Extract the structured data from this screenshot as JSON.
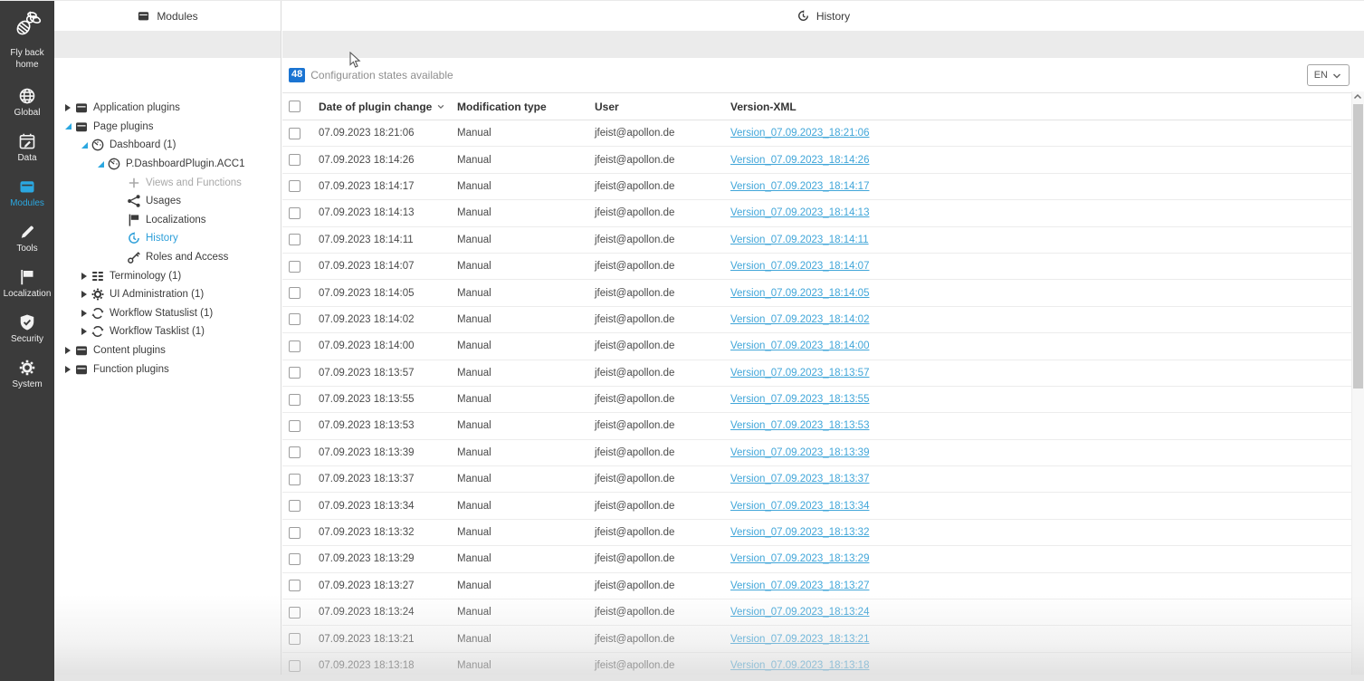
{
  "colors": {
    "accent": "#2ba7e0",
    "badge": "#1b74d2",
    "link": "#41a6d9",
    "sidebar_bg": "#3b3b3b"
  },
  "sidebar": {
    "logo": {
      "label": "Fly back home",
      "icon": "bee-icon"
    },
    "items": [
      {
        "label": "Global",
        "icon": "globe-icon",
        "active": false
      },
      {
        "label": "Data",
        "icon": "calendar-icon",
        "active": false
      },
      {
        "label": "Modules",
        "icon": "module-icon",
        "active": true
      },
      {
        "label": "Tools",
        "icon": "pencil-icon",
        "active": false
      },
      {
        "label": "Localization",
        "icon": "flag-icon",
        "active": false
      },
      {
        "label": "Security",
        "icon": "shield-icon",
        "active": false
      },
      {
        "label": "System",
        "icon": "gear-wrench-icon",
        "active": false
      }
    ]
  },
  "tree_panel": {
    "header": {
      "label": "Modules",
      "icon": "module-icon"
    },
    "items": [
      {
        "label": "Application plugins",
        "icon": "module-icon",
        "level": 0,
        "arrow": "collapsed",
        "state": "normal"
      },
      {
        "label": "Page plugins",
        "icon": "module-icon",
        "level": 0,
        "arrow": "expanded",
        "state": "normal"
      },
      {
        "label": "Dashboard (1)",
        "icon": "dashboard-icon",
        "level": 1,
        "arrow": "expanded",
        "state": "normal"
      },
      {
        "label": "P.DashboardPlugin.ACC1",
        "icon": "dashboard-icon",
        "level": 2,
        "arrow": "expanded",
        "state": "normal"
      },
      {
        "label": "Views and Functions",
        "icon": "plus-icon",
        "level": 3,
        "arrow": "none",
        "state": "muted"
      },
      {
        "label": "Usages",
        "icon": "usages-icon",
        "level": 3,
        "arrow": "none",
        "state": "normal"
      },
      {
        "label": "Localizations",
        "icon": "flag-icon",
        "level": 3,
        "arrow": "none",
        "state": "normal"
      },
      {
        "label": "History",
        "icon": "history-icon",
        "level": 3,
        "arrow": "none",
        "state": "active"
      },
      {
        "label": "Roles and Access",
        "icon": "key-icon",
        "level": 3,
        "arrow": "none",
        "state": "normal"
      },
      {
        "label": "Terminology (1)",
        "icon": "terminology-icon",
        "level": 1,
        "arrow": "collapsed",
        "state": "normal"
      },
      {
        "label": "UI Administration (1)",
        "icon": "gear-icon",
        "level": 1,
        "arrow": "collapsed",
        "state": "normal"
      },
      {
        "label": "Workflow Statuslist (1)",
        "icon": "workflow-icon",
        "level": 1,
        "arrow": "collapsed",
        "state": "normal"
      },
      {
        "label": "Workflow Tasklist (1)",
        "icon": "workflow-icon",
        "level": 1,
        "arrow": "collapsed",
        "state": "normal"
      },
      {
        "label": "Content plugins",
        "icon": "module-icon",
        "level": 0,
        "arrow": "collapsed",
        "state": "normal"
      },
      {
        "label": "Function plugins",
        "icon": "module-icon",
        "level": 0,
        "arrow": "collapsed",
        "state": "normal"
      }
    ]
  },
  "main": {
    "header": {
      "label": "History",
      "icon": "history-icon"
    },
    "toolbar": {
      "count": "48",
      "count_label": "Configuration states available",
      "language": "EN"
    },
    "table": {
      "columns": [
        "Date of plugin change",
        "Modification type",
        "User",
        "Version-XML"
      ],
      "sorted_column": "Date of plugin change",
      "rows": [
        {
          "date": "07.09.2023 18:21:06",
          "type": "Manual",
          "user": "jfeist@apollon.de",
          "version": "Version_07.09.2023_18:21:06"
        },
        {
          "date": "07.09.2023 18:14:26",
          "type": "Manual",
          "user": "jfeist@apollon.de",
          "version": "Version_07.09.2023_18:14:26"
        },
        {
          "date": "07.09.2023 18:14:17",
          "type": "Manual",
          "user": "jfeist@apollon.de",
          "version": "Version_07.09.2023_18:14:17"
        },
        {
          "date": "07.09.2023 18:14:13",
          "type": "Manual",
          "user": "jfeist@apollon.de",
          "version": "Version_07.09.2023_18:14:13"
        },
        {
          "date": "07.09.2023 18:14:11",
          "type": "Manual",
          "user": "jfeist@apollon.de",
          "version": "Version_07.09.2023_18:14:11"
        },
        {
          "date": "07.09.2023 18:14:07",
          "type": "Manual",
          "user": "jfeist@apollon.de",
          "version": "Version_07.09.2023_18:14:07"
        },
        {
          "date": "07.09.2023 18:14:05",
          "type": "Manual",
          "user": "jfeist@apollon.de",
          "version": "Version_07.09.2023_18:14:05"
        },
        {
          "date": "07.09.2023 18:14:02",
          "type": "Manual",
          "user": "jfeist@apollon.de",
          "version": "Version_07.09.2023_18:14:02"
        },
        {
          "date": "07.09.2023 18:14:00",
          "type": "Manual",
          "user": "jfeist@apollon.de",
          "version": "Version_07.09.2023_18:14:00"
        },
        {
          "date": "07.09.2023 18:13:57",
          "type": "Manual",
          "user": "jfeist@apollon.de",
          "version": "Version_07.09.2023_18:13:57"
        },
        {
          "date": "07.09.2023 18:13:55",
          "type": "Manual",
          "user": "jfeist@apollon.de",
          "version": "Version_07.09.2023_18:13:55"
        },
        {
          "date": "07.09.2023 18:13:53",
          "type": "Manual",
          "user": "jfeist@apollon.de",
          "version": "Version_07.09.2023_18:13:53"
        },
        {
          "date": "07.09.2023 18:13:39",
          "type": "Manual",
          "user": "jfeist@apollon.de",
          "version": "Version_07.09.2023_18:13:39"
        },
        {
          "date": "07.09.2023 18:13:37",
          "type": "Manual",
          "user": "jfeist@apollon.de",
          "version": "Version_07.09.2023_18:13:37"
        },
        {
          "date": "07.09.2023 18:13:34",
          "type": "Manual",
          "user": "jfeist@apollon.de",
          "version": "Version_07.09.2023_18:13:34"
        },
        {
          "date": "07.09.2023 18:13:32",
          "type": "Manual",
          "user": "jfeist@apollon.de",
          "version": "Version_07.09.2023_18:13:32"
        },
        {
          "date": "07.09.2023 18:13:29",
          "type": "Manual",
          "user": "jfeist@apollon.de",
          "version": "Version_07.09.2023_18:13:29"
        },
        {
          "date": "07.09.2023 18:13:27",
          "type": "Manual",
          "user": "jfeist@apollon.de",
          "version": "Version_07.09.2023_18:13:27"
        },
        {
          "date": "07.09.2023 18:13:24",
          "type": "Manual",
          "user": "jfeist@apollon.de",
          "version": "Version_07.09.2023_18:13:24"
        },
        {
          "date": "07.09.2023 18:13:21",
          "type": "Manual",
          "user": "jfeist@apollon.de",
          "version": "Version_07.09.2023_18:13:21"
        },
        {
          "date": "07.09.2023 18:13:18",
          "type": "Manual",
          "user": "jfeist@apollon.de",
          "version": "Version_07.09.2023_18:13:18"
        }
      ]
    }
  }
}
